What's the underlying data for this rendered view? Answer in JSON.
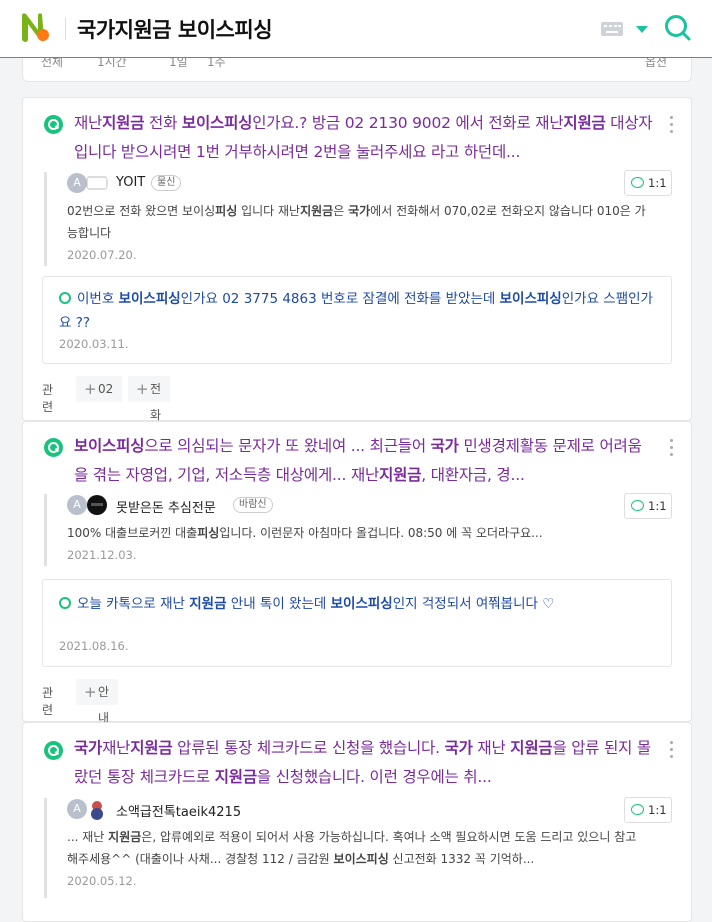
{
  "header": {
    "query": "국가지원금 보이스피싱"
  },
  "filters": [
    "전체",
    "1시간",
    "1일",
    "1주",
    "옵션"
  ],
  "results": [
    {
      "title_parts": [
        {
          "t": "재난",
          "c": "pur"
        },
        {
          "t": "지원금",
          "c": "pur b"
        },
        {
          "t": " 전화 ",
          "c": "pur"
        },
        {
          "t": "보이스피싱",
          "c": "pur b"
        },
        {
          "t": "인가요.? 방금 02 2130 9002 에서 전화로 재난",
          "c": "pur"
        },
        {
          "t": "지원금",
          "c": "pur b"
        },
        {
          "t": " 대상자입니다 받으시려면 1번 거부하시려면 2번을 눌러주세요 라고 하던데...",
          "c": "pur"
        }
      ],
      "answer": {
        "avatar_letter": "A",
        "name": "YOIT",
        "badge": "물신",
        "body_parts": [
          {
            "t": "02번으로 전화 왔으면 보이싱",
            "c": ""
          },
          {
            "t": "피싱",
            "c": "b"
          },
          {
            "t": " 입니다 재난",
            "c": ""
          },
          {
            "t": "지원금",
            "c": "b"
          },
          {
            "t": "은 ",
            "c": ""
          },
          {
            "t": "국가",
            "c": "b"
          },
          {
            "t": "에서 전화해서 070,02로 전화오지 않습니다 010은 가능합니다",
            "c": ""
          }
        ],
        "date": "2020.07.20.",
        "reply_count": "1:1"
      },
      "sub_q": {
        "parts": [
          {
            "t": "이번호 ",
            "c": ""
          },
          {
            "t": "보이스피싱",
            "c": "b"
          },
          {
            "t": "인가요 02 3775 4863 번호로 잠결에 전화를 받았는데 ",
            "c": ""
          },
          {
            "t": "보이스피싱",
            "c": "b"
          },
          {
            "t": "인가요 스팸인가요 ??",
            "c": ""
          }
        ],
        "date": "2020.03.11."
      },
      "tags_label": "관련",
      "tags": [
        "02",
        "전화"
      ]
    },
    {
      "title_parts": [
        {
          "t": "보이스피싱",
          "c": "pur b"
        },
        {
          "t": "으로 의심되는 문자가 또 왔네여 ... 최근들어 ",
          "c": "pur"
        },
        {
          "t": "국가",
          "c": "pur b"
        },
        {
          "t": " 민생경제활동 문제로 어려움을 겪는 자영업, 기업, 저소득층 대상에게... 재난",
          "c": "pur"
        },
        {
          "t": "지원금",
          "c": "pur b"
        },
        {
          "t": ", 대환자금, 경...",
          "c": "pur"
        }
      ],
      "answer": {
        "avatar_letter": "A",
        "name": "못받은돈 추심전문",
        "badge": "바람신",
        "body_parts": [
          {
            "t": "100% 대출브로커낀 대출",
            "c": ""
          },
          {
            "t": "피싱",
            "c": "b"
          },
          {
            "t": "입니다. 이런문자 아침마다 올겁니다. 08:50 에 꼭 오더라구요...",
            "c": ""
          }
        ],
        "date": "2021.12.03.",
        "reply_count": "1:1"
      },
      "sub_q": {
        "parts": [
          {
            "t": "오늘 카톡으로 재난 ",
            "c": ""
          },
          {
            "t": "지원금",
            "c": "b"
          },
          {
            "t": " 안내 톡이 왔는데 ",
            "c": ""
          },
          {
            "t": "보이스피싱",
            "c": "b"
          },
          {
            "t": "인지 걱정되서 여쭤봅니다 ♡",
            "c": ""
          }
        ],
        "date": "2021.08.16."
      },
      "tags_label": "관련",
      "tags": [
        "안내"
      ]
    },
    {
      "title_parts": [
        {
          "t": "국가",
          "c": "pur b"
        },
        {
          "t": "재난",
          "c": "pur"
        },
        {
          "t": "지원금",
          "c": "pur b"
        },
        {
          "t": " 압류된 통장 체크카드로 신청을 했습니다. ",
          "c": "pur"
        },
        {
          "t": "국가",
          "c": "pur b"
        },
        {
          "t": " 재난 ",
          "c": "pur"
        },
        {
          "t": "지원금",
          "c": "pur b"
        },
        {
          "t": "을 압류 된지 몰랐던 통장 체크카드로 ",
          "c": "pur"
        },
        {
          "t": "지원금",
          "c": "pur b"
        },
        {
          "t": "을 신청했습니다. 이런 경우에는 취...",
          "c": "pur"
        }
      ],
      "answer": {
        "avatar_letter": "A",
        "name": "소액급전톡taeik4215",
        "badge": "",
        "body_parts": [
          {
            "t": "... 재난 ",
            "c": ""
          },
          {
            "t": "지원금",
            "c": "b"
          },
          {
            "t": "은, 압류예외로 적용이 되어서 사용 가능하십니다. 혹여나 소액 필요하시면 도움 드리고 있으니 참고해주세용^^ (대출이나 사채... 경찰청 112 / 금감원 ",
            "c": ""
          },
          {
            "t": "보이스피싱",
            "c": "b"
          },
          {
            "t": " 신고전화 1332 꼭 기억하...",
            "c": ""
          }
        ],
        "date": "2020.05.12.",
        "reply_count": "1:1"
      }
    }
  ]
}
